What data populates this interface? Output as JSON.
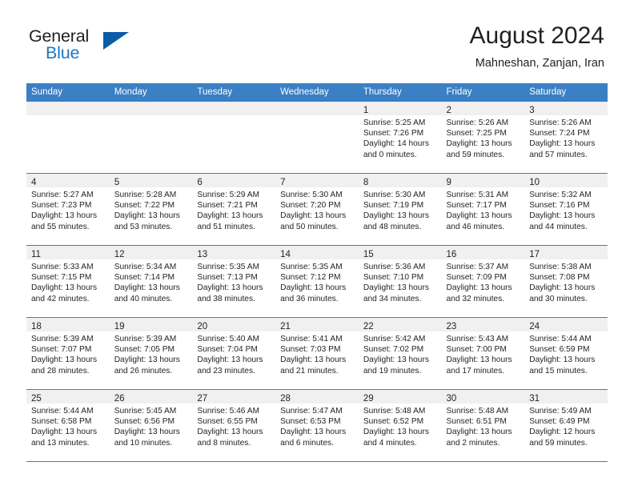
{
  "brand": {
    "line1": "General",
    "line2": "Blue",
    "triangle_icon": "brand-triangle-icon",
    "color_dark": "#231f20",
    "color_blue": "#1b77c4",
    "color_triangle": "#0a5ca8"
  },
  "header": {
    "month_title": "August 2024",
    "location": "Mahneshan, Zanjan, Iran"
  },
  "theme": {
    "header_bar": "#3b7fc4",
    "day_band": "#f0f0f0",
    "text": "#231f20"
  },
  "weekdays": [
    "Sunday",
    "Monday",
    "Tuesday",
    "Wednesday",
    "Thursday",
    "Friday",
    "Saturday"
  ],
  "weeks": [
    [
      {
        "day": "",
        "sunrise": "",
        "sunset": "",
        "daylight1": "",
        "daylight2": ""
      },
      {
        "day": "",
        "sunrise": "",
        "sunset": "",
        "daylight1": "",
        "daylight2": ""
      },
      {
        "day": "",
        "sunrise": "",
        "sunset": "",
        "daylight1": "",
        "daylight2": ""
      },
      {
        "day": "",
        "sunrise": "",
        "sunset": "",
        "daylight1": "",
        "daylight2": ""
      },
      {
        "day": "1",
        "sunrise": "Sunrise: 5:25 AM",
        "sunset": "Sunset: 7:26 PM",
        "daylight1": "Daylight: 14 hours",
        "daylight2": "and 0 minutes."
      },
      {
        "day": "2",
        "sunrise": "Sunrise: 5:26 AM",
        "sunset": "Sunset: 7:25 PM",
        "daylight1": "Daylight: 13 hours",
        "daylight2": "and 59 minutes."
      },
      {
        "day": "3",
        "sunrise": "Sunrise: 5:26 AM",
        "sunset": "Sunset: 7:24 PM",
        "daylight1": "Daylight: 13 hours",
        "daylight2": "and 57 minutes."
      }
    ],
    [
      {
        "day": "4",
        "sunrise": "Sunrise: 5:27 AM",
        "sunset": "Sunset: 7:23 PM",
        "daylight1": "Daylight: 13 hours",
        "daylight2": "and 55 minutes."
      },
      {
        "day": "5",
        "sunrise": "Sunrise: 5:28 AM",
        "sunset": "Sunset: 7:22 PM",
        "daylight1": "Daylight: 13 hours",
        "daylight2": "and 53 minutes."
      },
      {
        "day": "6",
        "sunrise": "Sunrise: 5:29 AM",
        "sunset": "Sunset: 7:21 PM",
        "daylight1": "Daylight: 13 hours",
        "daylight2": "and 51 minutes."
      },
      {
        "day": "7",
        "sunrise": "Sunrise: 5:30 AM",
        "sunset": "Sunset: 7:20 PM",
        "daylight1": "Daylight: 13 hours",
        "daylight2": "and 50 minutes."
      },
      {
        "day": "8",
        "sunrise": "Sunrise: 5:30 AM",
        "sunset": "Sunset: 7:19 PM",
        "daylight1": "Daylight: 13 hours",
        "daylight2": "and 48 minutes."
      },
      {
        "day": "9",
        "sunrise": "Sunrise: 5:31 AM",
        "sunset": "Sunset: 7:17 PM",
        "daylight1": "Daylight: 13 hours",
        "daylight2": "and 46 minutes."
      },
      {
        "day": "10",
        "sunrise": "Sunrise: 5:32 AM",
        "sunset": "Sunset: 7:16 PM",
        "daylight1": "Daylight: 13 hours",
        "daylight2": "and 44 minutes."
      }
    ],
    [
      {
        "day": "11",
        "sunrise": "Sunrise: 5:33 AM",
        "sunset": "Sunset: 7:15 PM",
        "daylight1": "Daylight: 13 hours",
        "daylight2": "and 42 minutes."
      },
      {
        "day": "12",
        "sunrise": "Sunrise: 5:34 AM",
        "sunset": "Sunset: 7:14 PM",
        "daylight1": "Daylight: 13 hours",
        "daylight2": "and 40 minutes."
      },
      {
        "day": "13",
        "sunrise": "Sunrise: 5:35 AM",
        "sunset": "Sunset: 7:13 PM",
        "daylight1": "Daylight: 13 hours",
        "daylight2": "and 38 minutes."
      },
      {
        "day": "14",
        "sunrise": "Sunrise: 5:35 AM",
        "sunset": "Sunset: 7:12 PM",
        "daylight1": "Daylight: 13 hours",
        "daylight2": "and 36 minutes."
      },
      {
        "day": "15",
        "sunrise": "Sunrise: 5:36 AM",
        "sunset": "Sunset: 7:10 PM",
        "daylight1": "Daylight: 13 hours",
        "daylight2": "and 34 minutes."
      },
      {
        "day": "16",
        "sunrise": "Sunrise: 5:37 AM",
        "sunset": "Sunset: 7:09 PM",
        "daylight1": "Daylight: 13 hours",
        "daylight2": "and 32 minutes."
      },
      {
        "day": "17",
        "sunrise": "Sunrise: 5:38 AM",
        "sunset": "Sunset: 7:08 PM",
        "daylight1": "Daylight: 13 hours",
        "daylight2": "and 30 minutes."
      }
    ],
    [
      {
        "day": "18",
        "sunrise": "Sunrise: 5:39 AM",
        "sunset": "Sunset: 7:07 PM",
        "daylight1": "Daylight: 13 hours",
        "daylight2": "and 28 minutes."
      },
      {
        "day": "19",
        "sunrise": "Sunrise: 5:39 AM",
        "sunset": "Sunset: 7:05 PM",
        "daylight1": "Daylight: 13 hours",
        "daylight2": "and 26 minutes."
      },
      {
        "day": "20",
        "sunrise": "Sunrise: 5:40 AM",
        "sunset": "Sunset: 7:04 PM",
        "daylight1": "Daylight: 13 hours",
        "daylight2": "and 23 minutes."
      },
      {
        "day": "21",
        "sunrise": "Sunrise: 5:41 AM",
        "sunset": "Sunset: 7:03 PM",
        "daylight1": "Daylight: 13 hours",
        "daylight2": "and 21 minutes."
      },
      {
        "day": "22",
        "sunrise": "Sunrise: 5:42 AM",
        "sunset": "Sunset: 7:02 PM",
        "daylight1": "Daylight: 13 hours",
        "daylight2": "and 19 minutes."
      },
      {
        "day": "23",
        "sunrise": "Sunrise: 5:43 AM",
        "sunset": "Sunset: 7:00 PM",
        "daylight1": "Daylight: 13 hours",
        "daylight2": "and 17 minutes."
      },
      {
        "day": "24",
        "sunrise": "Sunrise: 5:44 AM",
        "sunset": "Sunset: 6:59 PM",
        "daylight1": "Daylight: 13 hours",
        "daylight2": "and 15 minutes."
      }
    ],
    [
      {
        "day": "25",
        "sunrise": "Sunrise: 5:44 AM",
        "sunset": "Sunset: 6:58 PM",
        "daylight1": "Daylight: 13 hours",
        "daylight2": "and 13 minutes."
      },
      {
        "day": "26",
        "sunrise": "Sunrise: 5:45 AM",
        "sunset": "Sunset: 6:56 PM",
        "daylight1": "Daylight: 13 hours",
        "daylight2": "and 10 minutes."
      },
      {
        "day": "27",
        "sunrise": "Sunrise: 5:46 AM",
        "sunset": "Sunset: 6:55 PM",
        "daylight1": "Daylight: 13 hours",
        "daylight2": "and 8 minutes."
      },
      {
        "day": "28",
        "sunrise": "Sunrise: 5:47 AM",
        "sunset": "Sunset: 6:53 PM",
        "daylight1": "Daylight: 13 hours",
        "daylight2": "and 6 minutes."
      },
      {
        "day": "29",
        "sunrise": "Sunrise: 5:48 AM",
        "sunset": "Sunset: 6:52 PM",
        "daylight1": "Daylight: 13 hours",
        "daylight2": "and 4 minutes."
      },
      {
        "day": "30",
        "sunrise": "Sunrise: 5:48 AM",
        "sunset": "Sunset: 6:51 PM",
        "daylight1": "Daylight: 13 hours",
        "daylight2": "and 2 minutes."
      },
      {
        "day": "31",
        "sunrise": "Sunrise: 5:49 AM",
        "sunset": "Sunset: 6:49 PM",
        "daylight1": "Daylight: 12 hours",
        "daylight2": "and 59 minutes."
      }
    ]
  ]
}
